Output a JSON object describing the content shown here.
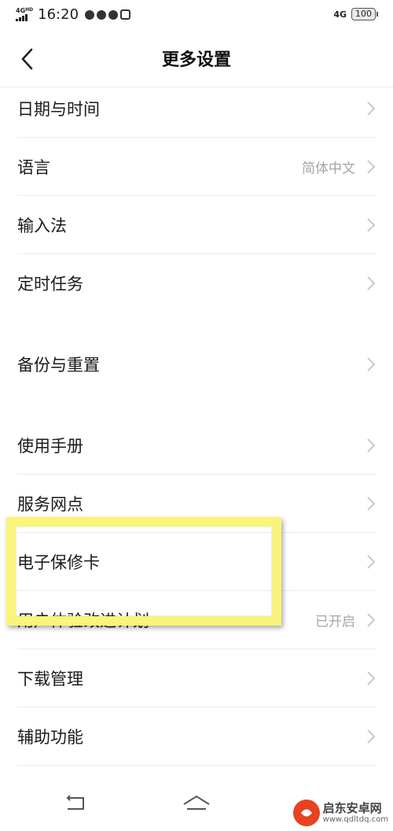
{
  "status_bar": {
    "signal_label": "4G",
    "signal_hd": "HD",
    "time": "16:20",
    "network_right": "4G",
    "battery": "100"
  },
  "header": {
    "title": "更多设置"
  },
  "settings": {
    "items": [
      {
        "label": "日期与时间",
        "value": ""
      },
      {
        "label": "语言",
        "value": "简体中文"
      },
      {
        "label": "输入法",
        "value": ""
      },
      {
        "label": "定时任务",
        "value": ""
      },
      {
        "label": "备份与重置",
        "value": ""
      },
      {
        "label": "使用手册",
        "value": ""
      },
      {
        "label": "服务网点",
        "value": ""
      },
      {
        "label": "电子保修卡",
        "value": ""
      },
      {
        "label": "用户体验改进计划",
        "value": "已开启"
      },
      {
        "label": "下载管理",
        "value": ""
      },
      {
        "label": "辅助功能",
        "value": ""
      }
    ]
  },
  "nav": {
    "icons": [
      "back-nav-icon",
      "home-nav-icon"
    ]
  },
  "watermark": {
    "cn": "启东安卓网",
    "en": "www.qdltdq.com"
  },
  "colors": {
    "highlight": "#f8f57a",
    "secondary_text": "#a6a6a6",
    "divider": "#ececec"
  }
}
